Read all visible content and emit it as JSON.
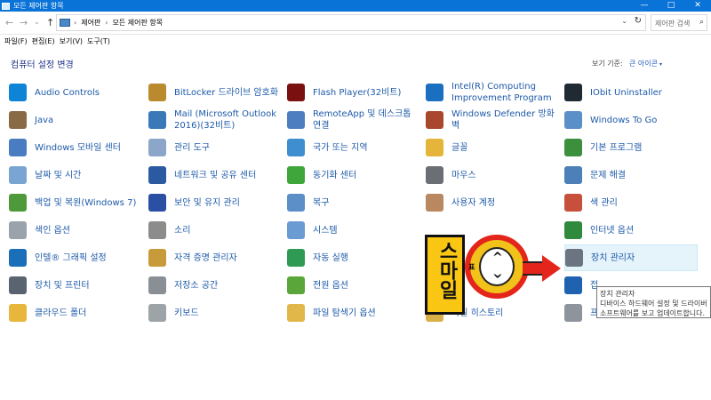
{
  "window": {
    "title": "모든 제어판 항목",
    "min": "—",
    "max": "□",
    "close": "✕"
  },
  "address": {
    "back": "←",
    "forward": "→",
    "recent": "⌄",
    "up": "↑",
    "crumbs": [
      "제어판",
      "모든 제어판 항목"
    ],
    "dropdown": "⌄",
    "refresh": "↻",
    "search_placeholder": "제어판 검색",
    "search_icon": "⌕"
  },
  "menu": [
    "파일(F)",
    "편집(E)",
    "보기(V)",
    "도구(T)"
  ],
  "page": {
    "title": "컴퓨터 설정 변경",
    "view_by": "보기 기준:",
    "view_mode": "큰 아이콘",
    "view_caret": "▾"
  },
  "items": [
    {
      "label": "Audio Controls",
      "icon": "hp-icon",
      "color": "#0d84d6",
      "col": 0,
      "row": 0
    },
    {
      "label": "Java",
      "icon": "java-icon",
      "color": "#8a6a45",
      "col": 0,
      "row": 1
    },
    {
      "label": "Windows 모바일 센터",
      "icon": "mobility-center-icon",
      "color": "#4a7cc2",
      "col": 0,
      "row": 2
    },
    {
      "label": "날짜 및 시간",
      "icon": "date-time-icon",
      "color": "#7aa4d2",
      "col": 0,
      "row": 3
    },
    {
      "label": "백업 및 복원(Windows 7)",
      "icon": "backup-icon",
      "color": "#4e9a3a",
      "col": 0,
      "row": 4
    },
    {
      "label": "색인 옵션",
      "icon": "indexing-icon",
      "color": "#9aa2ab",
      "col": 0,
      "row": 5
    },
    {
      "label": "인텔® 그래픽 설정",
      "icon": "intel-graphics-icon",
      "color": "#1a6fb8",
      "col": 0,
      "row": 6
    },
    {
      "label": "장치 및 프린터",
      "icon": "printer-icon",
      "color": "#5a6470",
      "col": 0,
      "row": 7
    },
    {
      "label": "클라우드 폴더",
      "icon": "cloud-folder-icon",
      "color": "#e8b63c",
      "col": 0,
      "row": 8
    },
    {
      "label": "BitLocker 드라이브 암호화",
      "icon": "bitlocker-icon",
      "color": "#b98b2e",
      "col": 1,
      "row": 0
    },
    {
      "label": "Mail (Microsoft Outlook 2016)(32비트)",
      "icon": "mail-icon",
      "color": "#3a78b8",
      "col": 1,
      "row": 1
    },
    {
      "label": "관리 도구",
      "icon": "admin-tools-icon",
      "color": "#8ba6c8",
      "col": 1,
      "row": 2
    },
    {
      "label": "네트워크 및 공유 센터",
      "icon": "network-icon",
      "color": "#2c5aa0",
      "col": 1,
      "row": 3
    },
    {
      "label": "보안 및 유지 관리",
      "icon": "flag-icon",
      "color": "#2b4fa2",
      "col": 1,
      "row": 4
    },
    {
      "label": "소리",
      "icon": "speaker-icon",
      "color": "#8c8c8c",
      "col": 1,
      "row": 5
    },
    {
      "label": "자격 증명 관리자",
      "icon": "credential-icon",
      "color": "#c79a3a",
      "col": 1,
      "row": 6
    },
    {
      "label": "저장소 공간",
      "icon": "storage-icon",
      "color": "#8a8f96",
      "col": 1,
      "row": 7
    },
    {
      "label": "키보드",
      "icon": "keyboard-icon",
      "color": "#9ea3a8",
      "col": 1,
      "row": 8
    },
    {
      "label": "Flash Player(32비트)",
      "icon": "flash-icon",
      "color": "#7a1010",
      "col": 2,
      "row": 0
    },
    {
      "label": "RemoteApp 및 데스크톱 연결",
      "icon": "remoteapp-icon",
      "color": "#4d7fc0",
      "col": 2,
      "row": 1
    },
    {
      "label": "국가 또는 지역",
      "icon": "region-icon",
      "color": "#3f8fd0",
      "col": 2,
      "row": 2
    },
    {
      "label": "동기화 센터",
      "icon": "sync-icon",
      "color": "#3ea63b",
      "col": 2,
      "row": 3
    },
    {
      "label": "복구",
      "icon": "recovery-icon",
      "color": "#5c8fc8",
      "col": 2,
      "row": 4
    },
    {
      "label": "시스템",
      "icon": "system-icon",
      "color": "#6a9bd2",
      "col": 2,
      "row": 5
    },
    {
      "label": "자동 실행",
      "icon": "autoplay-icon",
      "color": "#2e9a54",
      "col": 2,
      "row": 6
    },
    {
      "label": "전원 옵션",
      "icon": "power-icon",
      "color": "#5aa63a",
      "col": 2,
      "row": 7
    },
    {
      "label": "파일 탐색기 옵션",
      "icon": "folder-options-icon",
      "color": "#e2b74a",
      "col": 2,
      "row": 8
    },
    {
      "label": "Intel(R) Computing Improvement Program",
      "icon": "intel-icon",
      "color": "#1b6fc0",
      "col": 3,
      "row": 0
    },
    {
      "label": "Windows Defender 방화벽",
      "icon": "firewall-icon",
      "color": "#a9472c",
      "col": 3,
      "row": 1
    },
    {
      "label": "글꼴",
      "icon": "fonts-icon",
      "color": "#e5b43a",
      "col": 3,
      "row": 2
    },
    {
      "label": "마우스",
      "icon": "mouse-icon",
      "color": "#6a6f76",
      "col": 3,
      "row": 3
    },
    {
      "label": "사용자 계정",
      "icon": "user-accounts-icon",
      "color": "#b98760",
      "col": 3,
      "row": 4
    },
    {
      "label": "파일 히스토리",
      "icon": "file-history-icon",
      "color": "#d9b048",
      "col": 3,
      "row": 8
    },
    {
      "label": "IObit Uninstaller",
      "icon": "iobit-icon",
      "color": "#1f2a33",
      "col": 4,
      "row": 0
    },
    {
      "label": "Windows To Go",
      "icon": "windows-to-go-icon",
      "color": "#5a8fc8",
      "col": 4,
      "row": 1
    },
    {
      "label": "기본 프로그램",
      "icon": "default-programs-icon",
      "color": "#3b8f3d",
      "col": 4,
      "row": 2
    },
    {
      "label": "문제 해결",
      "icon": "troubleshoot-icon",
      "color": "#4d7fb8",
      "col": 4,
      "row": 3
    },
    {
      "label": "색 관리",
      "icon": "color-management-icon",
      "color": "#c6503c",
      "col": 4,
      "row": 4
    },
    {
      "label": "인터넷 옵션",
      "icon": "internet-options-icon",
      "color": "#2f8a3d",
      "col": 4,
      "row": 5
    },
    {
      "label": "장치 관리자",
      "icon": "device-manager-icon",
      "color": "#6b7480",
      "col": 4,
      "row": 6,
      "highlight": true
    },
    {
      "label": "접",
      "icon": "ease-of-access-icon",
      "color": "#1f63b0",
      "col": 4,
      "row": 7
    },
    {
      "label": "프로그램 및 기능",
      "icon": "programs-features-icon",
      "color": "#8d949c",
      "col": 4,
      "row": 8
    }
  ],
  "tooltip": {
    "title": "장치 관리자",
    "line1": "디바이스 하드웨어 설정 및 드라이버",
    "line2": "소프트웨어를 보고 업데이트합니다."
  },
  "overlay": {
    "stamp_text": "스마일",
    "circle_label": "표",
    "chev_up": "^",
    "chev_down": "^",
    "accent": "#e4251c",
    "fill": "#f9c614"
  }
}
